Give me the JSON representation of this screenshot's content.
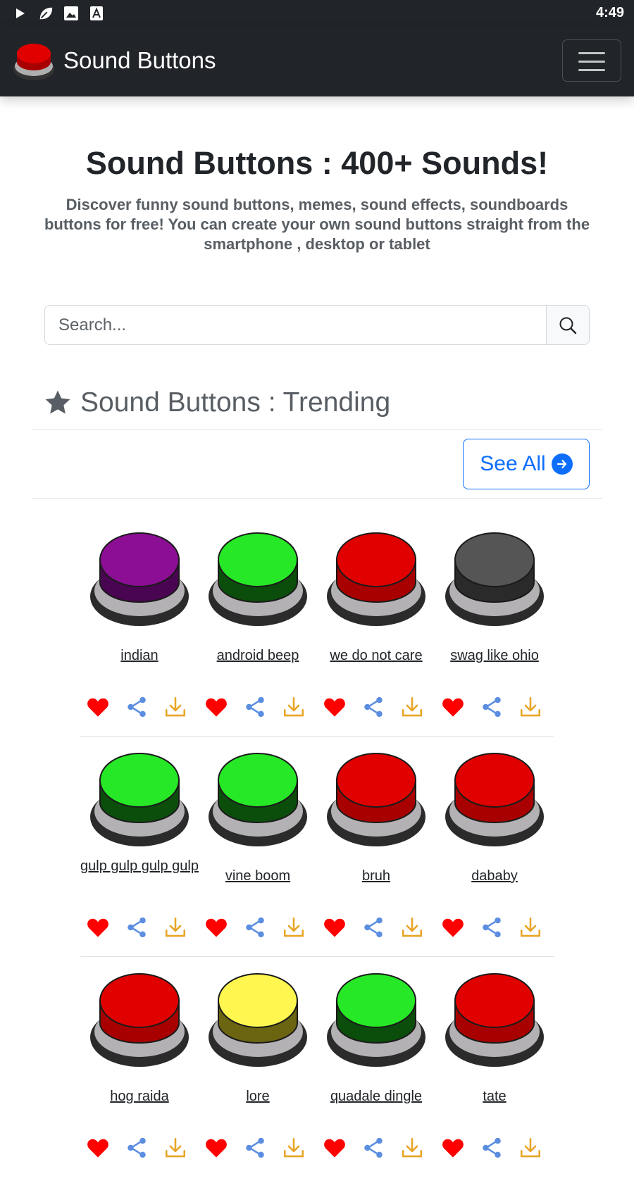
{
  "status_bar": {
    "time": "4:49",
    "icons": [
      "play-icon",
      "leaf-icon",
      "image-icon",
      "font-icon"
    ]
  },
  "navbar": {
    "brand": "Sound Buttons",
    "logo_icon": "red-button-icon",
    "menu_icon": "hamburger-menu-icon"
  },
  "hero": {
    "title": "Sound Buttons : 400+ Sounds!",
    "description": "Discover funny sound buttons, memes, sound effects, soundboards buttons for free! You can create your own sound buttons straight from the smartphone , desktop or tablet"
  },
  "search": {
    "placeholder": "Search...",
    "value": "",
    "icon": "search-icon"
  },
  "trending": {
    "title": "Sound Buttons : Trending",
    "icon": "star-icon",
    "see_all_label": "See All",
    "see_all_icon": "arrow-right-circle-icon"
  },
  "colors": {
    "navbar": "#212529",
    "accent": "#0d6efd",
    "heart": "#ff0000",
    "share": "#5b8ee0",
    "download": "#e8a526",
    "purple": "#8b0e95",
    "green": "#26e826",
    "red": "#e00000",
    "gray": "#555555",
    "yellow": "#fff650"
  },
  "sounds": [
    {
      "label": "indian",
      "color": "purple"
    },
    {
      "label": "android beep",
      "color": "green"
    },
    {
      "label": "we do not care",
      "color": "red"
    },
    {
      "label": "swag like ohio",
      "color": "gray"
    },
    {
      "label": "gulp gulp gulp gulp",
      "color": "green"
    },
    {
      "label": "vine boom",
      "color": "green"
    },
    {
      "label": "bruh",
      "color": "red"
    },
    {
      "label": "dababy",
      "color": "red"
    },
    {
      "label": "hog raida",
      "color": "red"
    },
    {
      "label": "lore",
      "color": "yellow"
    },
    {
      "label": "quadale dingle",
      "color": "green"
    },
    {
      "label": "tate",
      "color": "red"
    }
  ]
}
